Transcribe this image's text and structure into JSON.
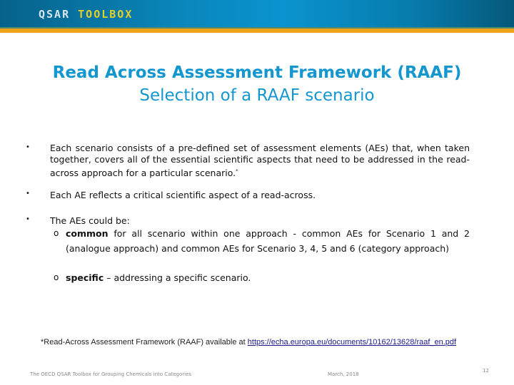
{
  "header": {
    "logo_part1": "QSAR",
    "logo_part2": "TOOLBOX",
    "colors": {
      "band": "#0a86bb",
      "stripe": "#f0a21a",
      "logo_toolbox": "#e4cf2a"
    }
  },
  "title": {
    "main": "Read Across Assessment Framework (RAAF)",
    "sub": "Selection of a RAAF scenario",
    "color": "#1496cf"
  },
  "bullets": [
    {
      "marker": "•",
      "text": "Each scenario consists of a pre-defined set of assessment elements (AEs) that, when taken together, covers all of the essential scientific aspects that need to be addressed in the read-across approach for a particular scenario.",
      "sup": "*"
    },
    {
      "marker": "•",
      "text": "Each AE reflects a critical scientific aspect of a read-across."
    },
    {
      "marker": "•",
      "text": "The AEs could be:",
      "subitems": [
        {
          "marker": "o",
          "bold": "common",
          "text": " for all scenario within one approach - common AEs for Scenario 1 and 2 (analogue approach) and common AEs for Scenario 3, 4, 5 and 6 (category approach)"
        },
        {
          "marker": "o",
          "bold": "specific",
          "text": " – addressing a specific scenario."
        }
      ]
    }
  ],
  "footnote": {
    "text": "*Read-Across Assessment Framework (RAAF) available at ",
    "link": "https://echa.europa.eu/documents/10162/13628/raaf_en.pdf"
  },
  "footer": {
    "left": "The OECD QSAR Toolbox for Grouping Chemicals into Categories",
    "date": "March, 2018",
    "page": "12"
  }
}
